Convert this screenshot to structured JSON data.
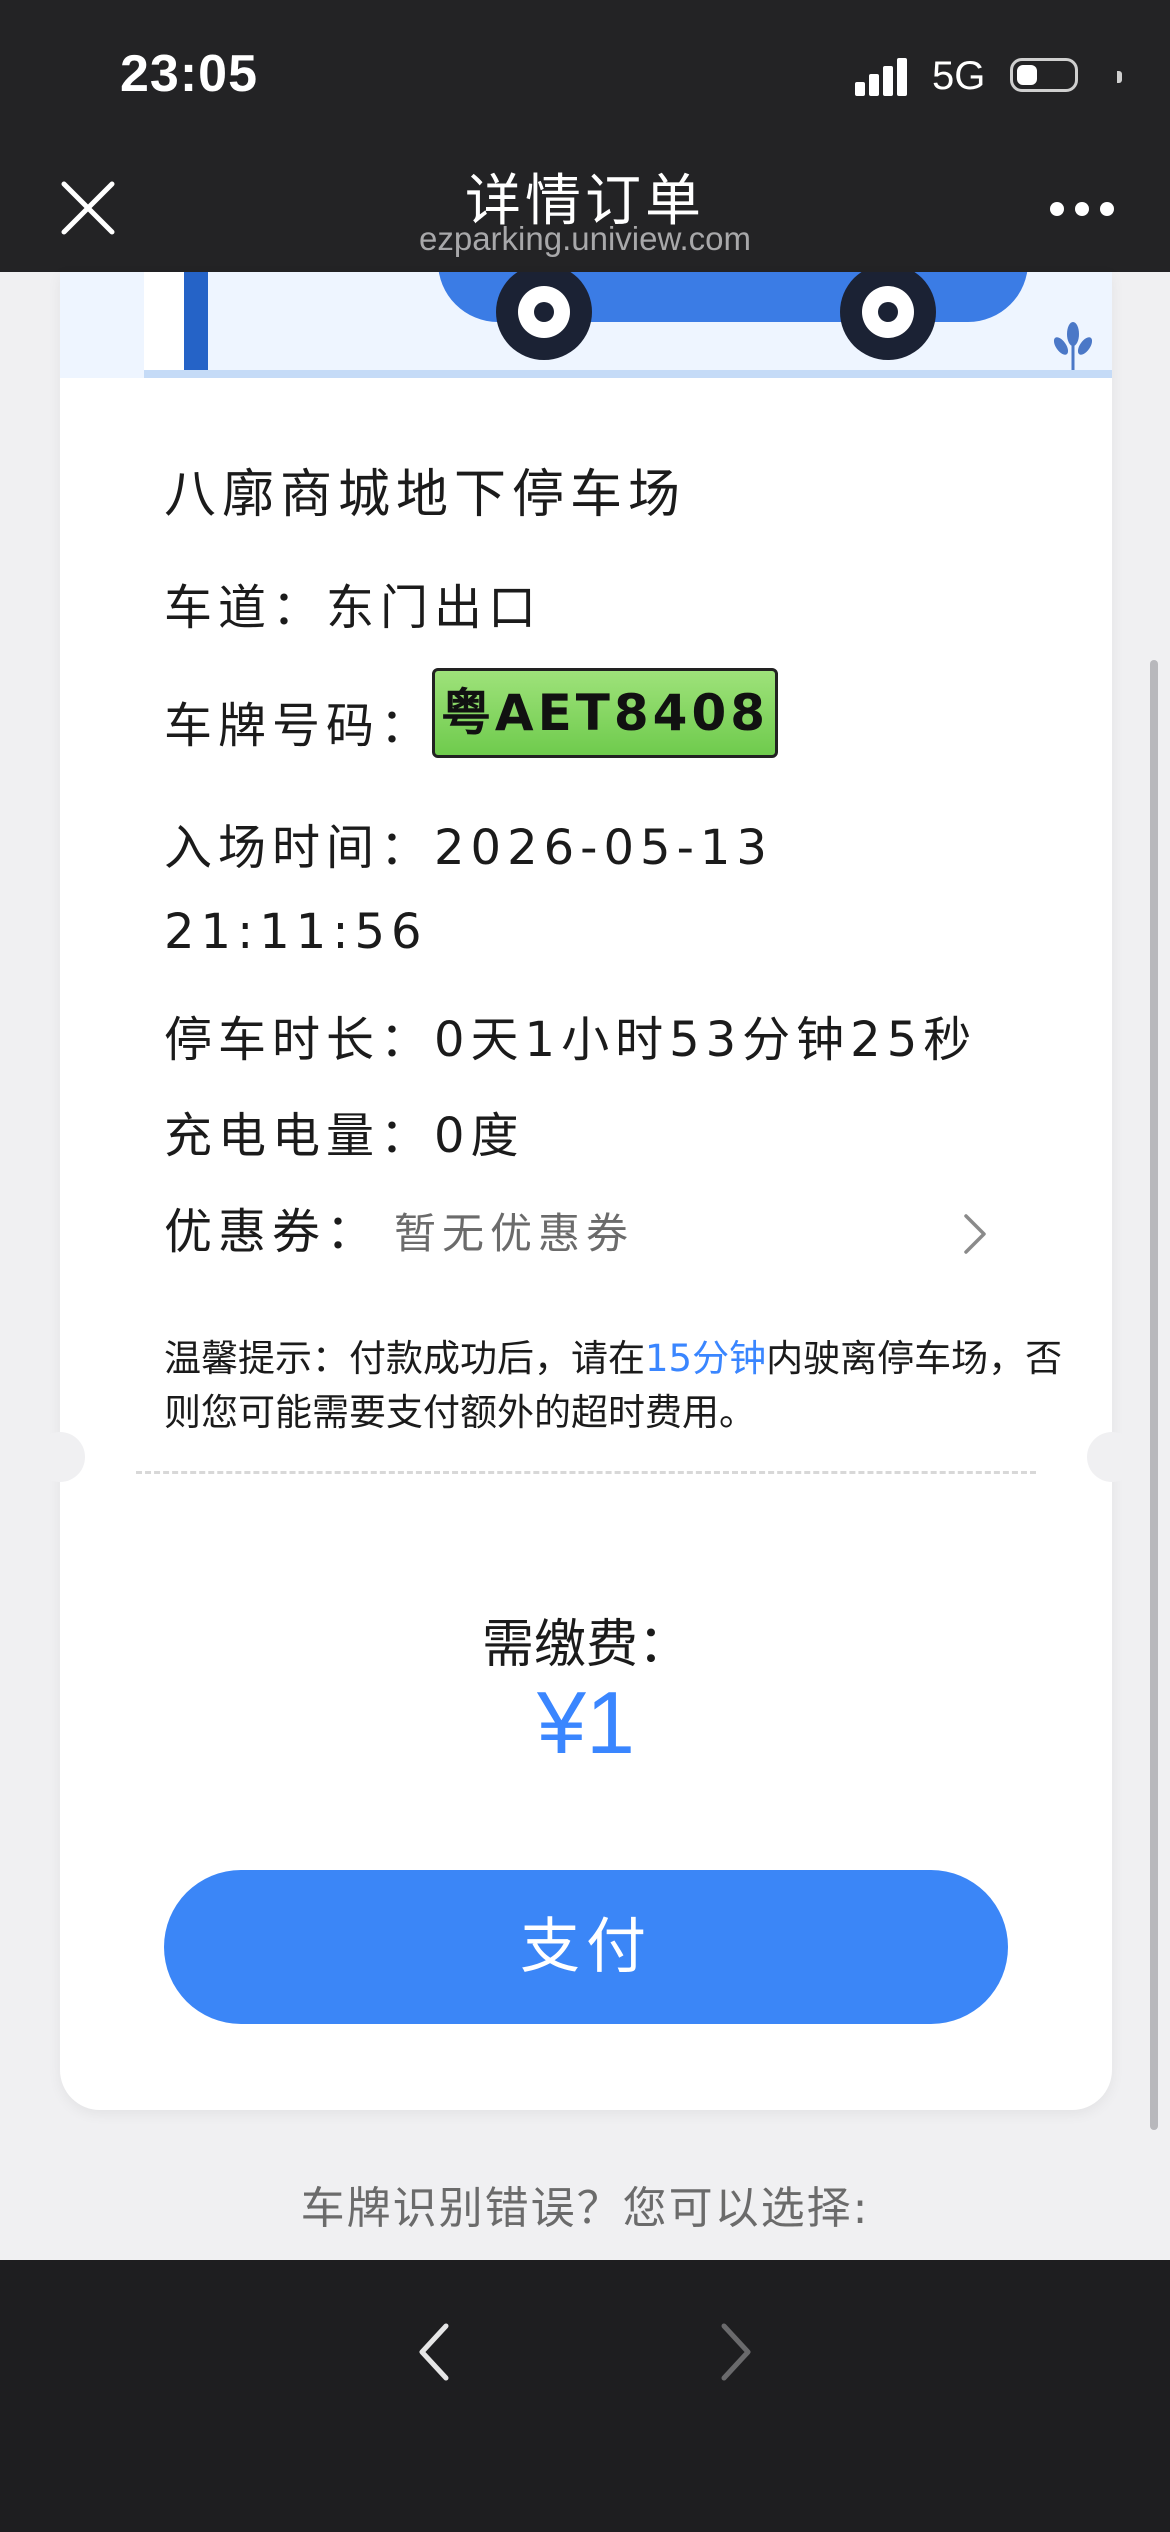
{
  "status_bar": {
    "time": "23:05",
    "network": "5G"
  },
  "nav": {
    "title": "详情订单",
    "url": "ezparking.uniview.com"
  },
  "order": {
    "lot_name": "八廓商城地下停车场",
    "lane_label": "车道：",
    "lane_value": "东门出口",
    "plate_label": "车牌号码：",
    "plate_value": "粤AET8408",
    "entry_label": "入场时间：",
    "entry_date": "2026-05-13",
    "entry_time": "21:11:56",
    "duration_label": "停车时长：",
    "duration_value": "0天1小时53分钟25秒",
    "charge_label": "充电电量：",
    "charge_value": "0度",
    "coupon_label": "优惠券：",
    "coupon_value": "暂无优惠券"
  },
  "tip": {
    "prefix": "温馨提示：付款成功后，请在",
    "highlight": "15分钟",
    "suffix": "内驶离停车场，否则您可能需要支付额外的超时费用。"
  },
  "payment": {
    "due_label": "需缴费：",
    "amount": "¥1",
    "pay_button": "支付"
  },
  "footer_hint": "车牌识别错误？您可以选择:",
  "colors": {
    "accent": "#3b86f7",
    "plate_green": "#7fd35a",
    "bar_dark": "#232325"
  },
  "icons": [
    "close-icon",
    "more-icon",
    "chevron-right-icon",
    "back-icon",
    "forward-icon"
  ]
}
